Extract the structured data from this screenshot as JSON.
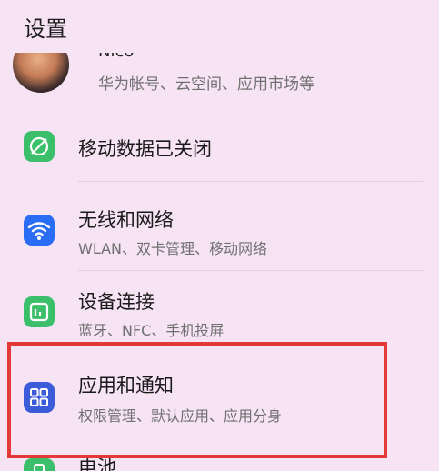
{
  "header": {
    "title": "设置"
  },
  "account": {
    "name": "Nico",
    "subtitle": "华为帐号、云空间、应用市场等"
  },
  "items": [
    {
      "title": "移动数据已关闭",
      "subtitle": ""
    },
    {
      "title": "无线和网络",
      "subtitle": "WLAN、双卡管理、移动网络"
    },
    {
      "title": "设备连接",
      "subtitle": "蓝牙、NFC、手机投屏"
    },
    {
      "title": "应用和通知",
      "subtitle": "权限管理、默认应用、应用分身"
    },
    {
      "title": "电池",
      "subtitle": ""
    }
  ],
  "colors": {
    "background": "#f6e3f4",
    "mobile_data_icon": "#3bbf6a",
    "wifi_icon": "#2a6df4",
    "device_icon": "#3bbf6a",
    "apps_icon": "#3b5bd9",
    "battery_icon": "#3bbf6a",
    "highlight": "#e53935"
  },
  "icons": {
    "mobile_data": "mobile-data-off-icon",
    "wireless": "wifi-icon",
    "device": "device-connection-icon",
    "apps": "apps-grid-icon",
    "battery": "battery-icon"
  }
}
